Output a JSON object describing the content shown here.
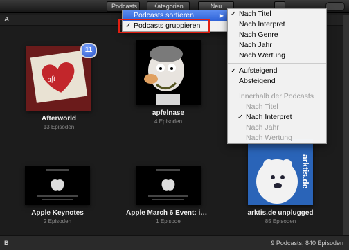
{
  "toolbar": {
    "buttons": [
      "Podcasts",
      "Kategorien",
      "Neu"
    ]
  },
  "sections": {
    "a": "A",
    "b": "B"
  },
  "podcasts": [
    {
      "title": "Afterworld",
      "sub": "13 Episoden",
      "badge": "11"
    },
    {
      "title": "apfelnase",
      "sub": "4 Episoden"
    },
    {
      "title": "Apple Keynotes",
      "sub": "2 Episoden"
    },
    {
      "title": "Apple March 6 Event: iPhone ...",
      "sub": "1 Episode"
    },
    {
      "title": "arktis.de unplugged",
      "sub": "85 Episoden",
      "art_text": "arktis.de"
    }
  ],
  "main_menu": {
    "sort_label": "Podcasts sortieren",
    "group_label": "Podcasts gruppieren"
  },
  "sort_menu": {
    "by": [
      "Nach Titel",
      "Nach Interpret",
      "Nach Genre",
      "Nach Jahr",
      "Nach Wertung"
    ],
    "order": [
      "Aufsteigend",
      "Absteigend"
    ],
    "within_label": "Innerhalb der Podcasts",
    "within": [
      "Nach Titel",
      "Nach Interpret",
      "Nach Jahr",
      "Nach Wertung"
    ]
  },
  "status": "9 Podcasts, 840 Episoden",
  "colors": {
    "highlight": "#2f63d8",
    "red_outline": "#e21f12"
  }
}
